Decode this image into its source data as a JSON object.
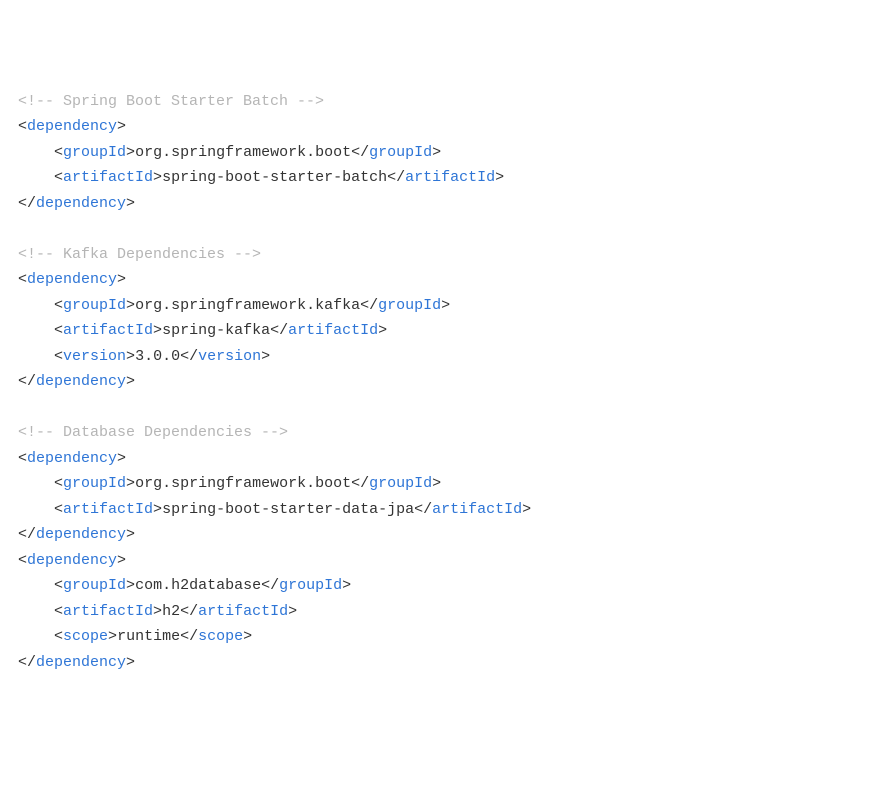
{
  "code": {
    "indent": "    ",
    "comments": {
      "batch": "<!-- Spring Boot Starter Batch -->",
      "kafka": "<!-- Kafka Dependencies -->",
      "db": "<!-- Database Dependencies -->"
    },
    "tags": {
      "dependency_open_l": "<",
      "dependency_open_name": "dependency",
      "dependency_open_r": ">",
      "dependency_close_l": "</",
      "dependency_close_name": "dependency",
      "dependency_close_r": ">",
      "groupId_open_l": "<",
      "groupId_open_name": "groupId",
      "groupId_open_r": ">",
      "groupId_close_l": "</",
      "groupId_close_name": "groupId",
      "groupId_close_r": ">",
      "artifactId_open_l": "<",
      "artifactId_open_name": "artifactId",
      "artifactId_open_r": ">",
      "artifactId_close_l": "</",
      "artifactId_close_name": "artifactId",
      "artifactId_close_r": ">",
      "version_open_l": "<",
      "version_open_name": "version",
      "version_open_r": ">",
      "version_close_l": "</",
      "version_close_name": "version",
      "version_close_r": ">",
      "scope_open_l": "<",
      "scope_open_name": "scope",
      "scope_open_r": ">",
      "scope_close_l": "</",
      "scope_close_name": "scope",
      "scope_close_r": ">"
    },
    "deps": {
      "batch": {
        "groupId": "org.springframework.boot",
        "artifactId": "spring-boot-starter-batch"
      },
      "kafka": {
        "groupId": "org.springframework.kafka",
        "artifactId": "spring-kafka",
        "version": "3.0.0"
      },
      "jpa": {
        "groupId": "org.springframework.boot",
        "artifactId": "spring-boot-starter-data-jpa"
      },
      "h2": {
        "groupId": "com.h2database",
        "artifactId": "h2",
        "scope": "runtime"
      }
    }
  }
}
